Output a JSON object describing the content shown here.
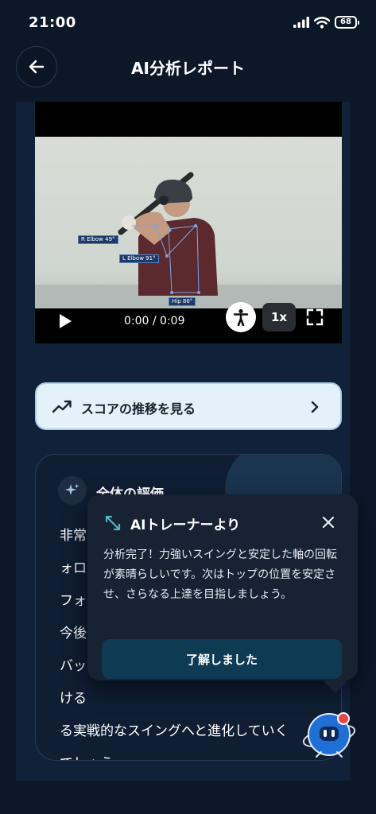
{
  "status_bar": {
    "time": "21:00",
    "battery": "68"
  },
  "header": {
    "title": "AI分析レポート"
  },
  "video": {
    "current_time": "0:00",
    "duration": "0:09",
    "time_display": "0:00 / 0:09",
    "speed": "1x",
    "pose_labels": {
      "r_elbow": "R Elbow 49°",
      "l_elbow": "L Elbow 91°",
      "hip": "Hip 86°"
    }
  },
  "score_trend": {
    "label": "スコアの推移を見る"
  },
  "evaluation": {
    "title": "全体の評価",
    "lines": [
      "非常",
      "ォロ",
      "フォ",
      "今後",
      "バッ",
      "ける",
      "る実戦的なスイングへと進化していく",
      "でしょう。"
    ]
  },
  "trainer_popup": {
    "title": "AIトレーナーより",
    "message": "分析完了！力強いスイングと安定した軸の回転が素晴らしいです。次はトップの位置を安定させ、さらなる上達を目指しましょう。",
    "ok_label": "了解しました"
  },
  "colors": {
    "background": "#0c1828",
    "panel": "#10213a",
    "score_button_bg": "#e3f1f9",
    "popup_bg": "#172233",
    "ok_button_bg": "#0f3a54",
    "accent_teal": "#4fb3c9"
  },
  "icons": {
    "back": "arrow-left-icon",
    "play": "play-icon",
    "pose": "person-icon",
    "fullscreen": "fullscreen-icon",
    "trend": "trending-up-icon",
    "chevron": "chevron-right-icon",
    "sparkle": "sparkle-icon",
    "trainer": "trainer-resize-icon",
    "close": "close-icon",
    "avatar": "ai-robot-avatar-icon"
  }
}
